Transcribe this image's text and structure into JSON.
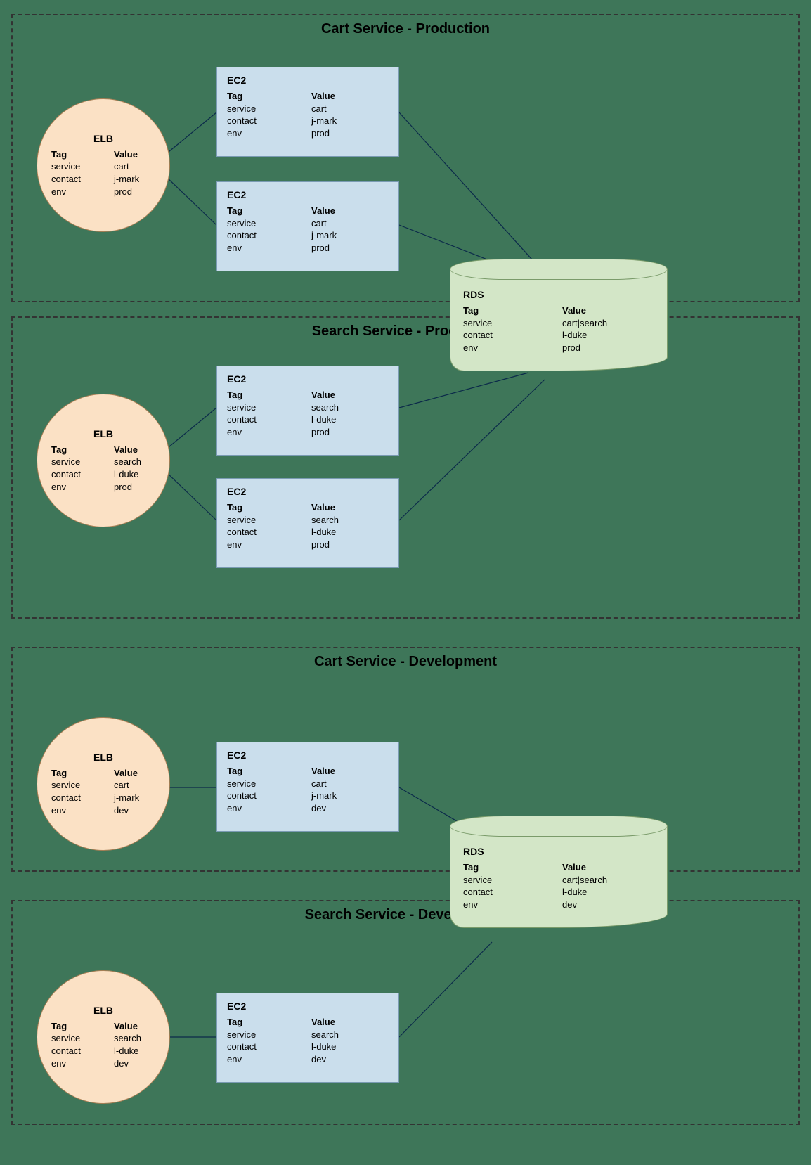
{
  "groups": [
    {
      "title": "Cart Service - Production"
    },
    {
      "title": "Search Service - Production"
    },
    {
      "title": "Cart Service - Development"
    },
    {
      "title": "Search Service - Development"
    }
  ],
  "boxes": {
    "elb1": {
      "name": "ELB",
      "tag_hdr": "Tag",
      "val_hdr": "Value",
      "r1k": "service",
      "r1v": "cart",
      "r2k": "contact",
      "r2v": "j-mark",
      "r3k": "env",
      "r3v": "prod"
    },
    "ec2a": {
      "name": "EC2",
      "tag_hdr": "Tag",
      "val_hdr": "Value",
      "r1k": "service",
      "r1v": "cart",
      "r2k": "contact",
      "r2v": "j-mark",
      "r3k": "env",
      "r3v": "prod"
    },
    "ec2b": {
      "name": "EC2",
      "tag_hdr": "Tag",
      "val_hdr": "Value",
      "r1k": "service",
      "r1v": "cart",
      "r2k": "contact",
      "r2v": "j-mark",
      "r3k": "env",
      "r3v": "prod"
    },
    "elb2": {
      "name": "ELB",
      "tag_hdr": "Tag",
      "val_hdr": "Value",
      "r1k": "service",
      "r1v": "search",
      "r2k": "contact",
      "r2v": "l-duke",
      "r3k": "env",
      "r3v": "prod"
    },
    "ec2c": {
      "name": "EC2",
      "tag_hdr": "Tag",
      "val_hdr": "Value",
      "r1k": "service",
      "r1v": "search",
      "r2k": "contact",
      "r2v": "l-duke",
      "r3k": "env",
      "r3v": "prod"
    },
    "ec2d": {
      "name": "EC2",
      "tag_hdr": "Tag",
      "val_hdr": "Value",
      "r1k": "service",
      "r1v": "search",
      "r2k": "contact",
      "r2v": "l-duke",
      "r3k": "env",
      "r3v": "prod"
    },
    "rds1": {
      "name": "RDS",
      "tag_hdr": "Tag",
      "val_hdr": "Value",
      "r1k": "service",
      "r1v": "cart|search",
      "r2k": "contact",
      "r2v": "l-duke",
      "r3k": "env",
      "r3v": "prod"
    },
    "elb3": {
      "name": "ELB",
      "tag_hdr": "Tag",
      "val_hdr": "Value",
      "r1k": "service",
      "r1v": "cart",
      "r2k": "contact",
      "r2v": "j-mark",
      "r3k": "env",
      "r3v": "dev"
    },
    "ec2e": {
      "name": "EC2",
      "tag_hdr": "Tag",
      "val_hdr": "Value",
      "r1k": "service",
      "r1v": "cart",
      "r2k": "contact",
      "r2v": "j-mark",
      "r3k": "env",
      "r3v": "dev"
    },
    "elb4": {
      "name": "ELB",
      "tag_hdr": "Tag",
      "val_hdr": "Value",
      "r1k": "service",
      "r1v": "search",
      "r2k": "contact",
      "r2v": "l-duke",
      "r3k": "env",
      "r3v": "dev"
    },
    "ec2f": {
      "name": "EC2",
      "tag_hdr": "Tag",
      "val_hdr": "Value",
      "r1k": "service",
      "r1v": "search",
      "r2k": "contact",
      "r2v": "l-duke",
      "r3k": "env",
      "r3v": "dev"
    },
    "rds2": {
      "name": "RDS",
      "tag_hdr": "Tag",
      "val_hdr": "Value",
      "r1k": "service",
      "r1v": "cart|search",
      "r2k": "contact",
      "r2v": "l-duke",
      "r3k": "env",
      "r3v": "dev"
    }
  }
}
